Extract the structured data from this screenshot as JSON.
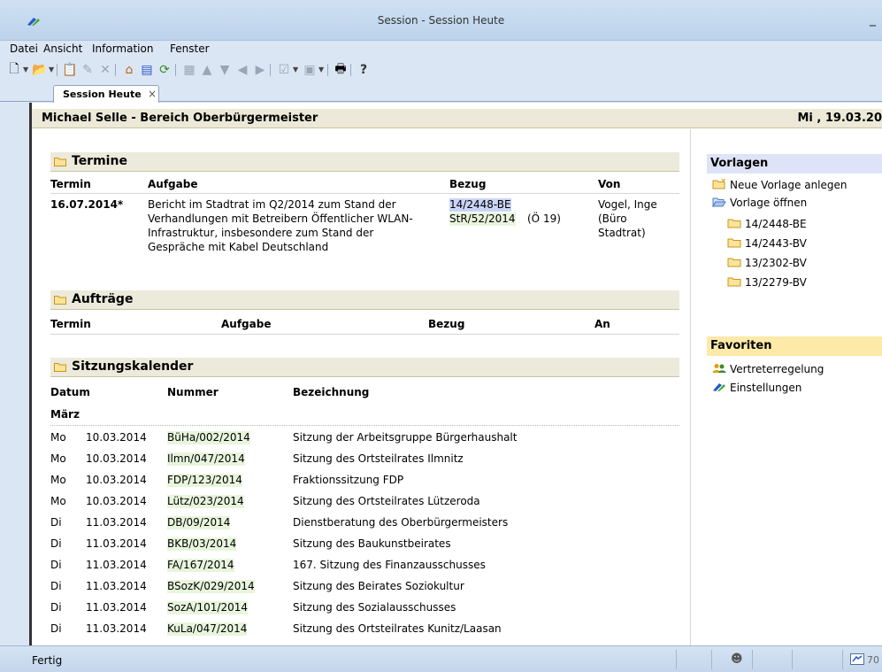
{
  "window": {
    "title": "Session - Session Heute",
    "minimize": "_"
  },
  "menu": [
    {
      "label": "Datei"
    },
    {
      "label": "Ansicht"
    },
    {
      "label": "Information"
    },
    {
      "label": "Fenster"
    }
  ],
  "tab": {
    "label": "Session Heute",
    "close": "×"
  },
  "header": {
    "user": "Michael Selle  -  Bereich Oberbürgermeister",
    "date": "Mi , 19.03.20"
  },
  "termine": {
    "title": "Termine",
    "columns": [
      "Termin",
      "Aufgabe",
      "Bezug",
      "Von"
    ],
    "row": {
      "termin": "16.07.2014*",
      "aufgabe": [
        "Bericht im Stadtrat im Q2/2014 zum Stand der",
        "Verhandlungen mit Betreibern Öffentlicher WLAN-",
        "Infrastruktur, insbesondere zum Stand der",
        "Gespräche mit Kabel Deutschland"
      ],
      "bezug1": "14/2448-BE",
      "bezug2": "StR/52/2014",
      "bezug2_note": "(Ö 19)",
      "von": [
        "Vogel, Inge",
        "(Büro",
        "Stadtrat)"
      ]
    }
  },
  "auftraege": {
    "title": "Aufträge",
    "columns": [
      "Termin",
      "Aufgabe",
      "Bezug",
      "An"
    ]
  },
  "kalender": {
    "title": "Sitzungskalender",
    "columns": [
      "Datum",
      "Nummer",
      "Bezeichnung"
    ],
    "month": "März",
    "rows": [
      {
        "day": "Mo",
        "date": "10.03.2014",
        "nr": "BüHa/002/2014",
        "desc": "Sitzung der Arbeitsgruppe Bürgerhaushalt"
      },
      {
        "day": "Mo",
        "date": "10.03.2014",
        "nr": "Ilmn/047/2014",
        "desc": "Sitzung des Ortsteilrates Ilmnitz"
      },
      {
        "day": "Mo",
        "date": "10.03.2014",
        "nr": "FDP/123/2014",
        "desc": "Fraktionssitzung FDP"
      },
      {
        "day": "Mo",
        "date": "10.03.2014",
        "nr": "Lütz/023/2014",
        "desc": "Sitzung des Ortsteilrates Lützeroda"
      },
      {
        "day": "Di",
        "date": "11.03.2014",
        "nr": "DB/09/2014",
        "desc": "Dienstberatung des Oberbürgermeisters"
      },
      {
        "day": "Di",
        "date": "11.03.2014",
        "nr": "BKB/03/2014",
        "desc": "Sitzung des Baukunstbeirates"
      },
      {
        "day": "Di",
        "date": "11.03.2014",
        "nr": "FA/167/2014",
        "desc": "167. Sitzung des Finanzausschusses"
      },
      {
        "day": "Di",
        "date": "11.03.2014",
        "nr": "BSozK/029/2014",
        "desc": "Sitzung des Beirates Soziokultur"
      },
      {
        "day": "Di",
        "date": "11.03.2014",
        "nr": "SozA/101/2014",
        "desc": "Sitzung des Sozialausschusses"
      },
      {
        "day": "Di",
        "date": "11.03.2014",
        "nr": "KuLa/047/2014",
        "desc": "Sitzung des Ortsteilrates Kunitz/Laasan"
      }
    ]
  },
  "sidebar": {
    "vorlagen_title": "Vorlagen",
    "neue_vorlage": "Neue Vorlage anlegen",
    "vorlage_oeffnen": "Vorlage öffnen",
    "vorlagen": [
      "14/2448-BE",
      "14/2443-BV",
      "13/2302-BV",
      "13/2279-BV"
    ],
    "favoriten_title": "Favoriten",
    "favoriten": [
      "Vertreterregelung",
      "Einstellungen"
    ]
  },
  "status": {
    "text": "Fertig",
    "zoom": "70"
  },
  "colors": {
    "selected_ref": "#c9d4f6",
    "ref": "#e8f5dd",
    "section": "#eceadb",
    "vorlagen_head": "#dfe3f7",
    "favoriten_head": "#fde9a8"
  }
}
